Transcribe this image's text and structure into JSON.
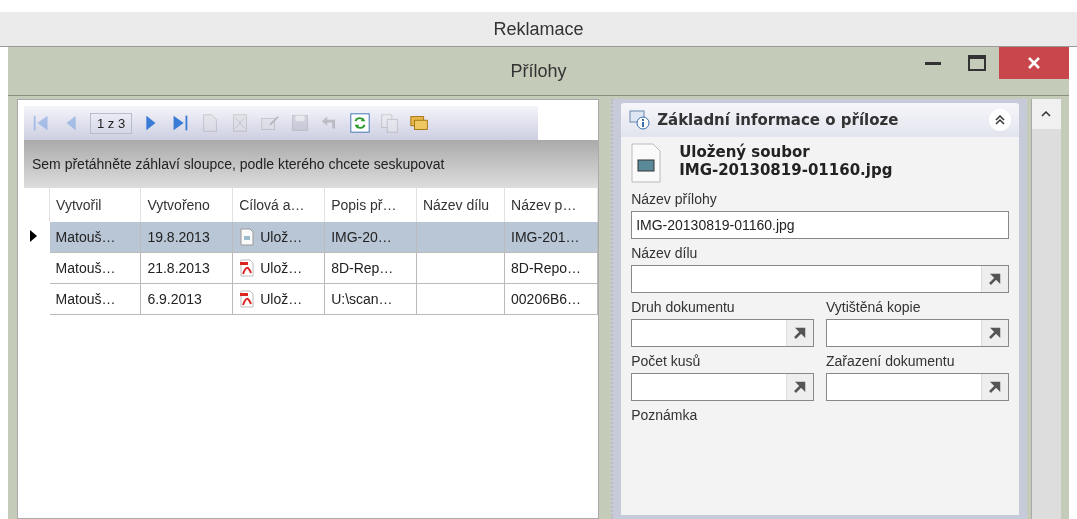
{
  "app_title": "Reklamace",
  "window": {
    "title": "Přílohy"
  },
  "toolbar": [
    {
      "kind": "first",
      "disabled": true
    },
    {
      "kind": "prev",
      "disabled": true
    },
    {
      "kind": "page",
      "text": "1 z 3"
    },
    {
      "kind": "next",
      "disabled": false
    },
    {
      "kind": "last",
      "disabled": false
    },
    {
      "kind": "new",
      "disabled": true
    },
    {
      "kind": "delete",
      "disabled": true
    },
    {
      "kind": "edit",
      "disabled": true
    },
    {
      "kind": "save",
      "disabled": true
    },
    {
      "kind": "undo",
      "disabled": true
    },
    {
      "kind": "refresh",
      "disabled": false
    },
    {
      "kind": "copy",
      "disabled": true
    },
    {
      "kind": "folders",
      "disabled": false
    }
  ],
  "group_panel": "Sem přetáhněte záhlaví sloupce, podle kterého chcete seskupovat",
  "table": {
    "columns": [
      "Vytvořil",
      "Vytvořeno",
      "Cílová a…",
      "Popis př…",
      "Název dílu",
      "Název p…"
    ],
    "rows": [
      {
        "selected": true,
        "kind": "image",
        "cells": [
          "Matouš…",
          "19.8.2013",
          "Ulož…",
          "IMG-20…",
          "",
          "IMG-201…"
        ]
      },
      {
        "selected": false,
        "kind": "pdf",
        "cells": [
          "Matouš…",
          "21.8.2013",
          "Ulož…",
          "8D-Rep…",
          "",
          "8D-Repo…"
        ]
      },
      {
        "selected": false,
        "kind": "pdf",
        "cells": [
          "Matouš…",
          "6.9.2013",
          "Ulož…",
          "U:\\scan…",
          "",
          "00206B6…"
        ]
      }
    ]
  },
  "detail": {
    "title": "Základní informace o příloze",
    "file_label": "Uložený soubor",
    "file_name": "IMG-20130819-01160.jpg",
    "field_rows": [
      [
        {
          "label": "Název přílohy",
          "value": "IMG-20130819-01160.jpg",
          "kind": "text"
        }
      ],
      [
        {
          "label": "Název dílu",
          "kind": "lookup"
        }
      ],
      [
        {
          "label": "Druh dokumentu",
          "kind": "lookup"
        },
        {
          "label": "Vytištěná kopie",
          "kind": "lookup"
        }
      ],
      [
        {
          "label": "Počet kusů",
          "kind": "lookup"
        },
        {
          "label": "Zařazení dokumentu",
          "kind": "lookup"
        }
      ],
      [
        {
          "label": "Poznámka",
          "kind": "label"
        }
      ]
    ]
  }
}
